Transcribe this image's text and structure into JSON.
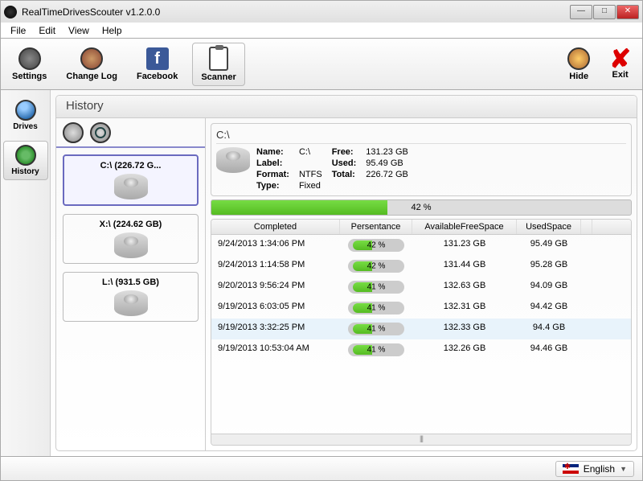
{
  "window": {
    "title": "RealTimeDrivesScouter v1.2.0.0"
  },
  "menu": {
    "file": "File",
    "edit": "Edit",
    "view": "View",
    "help": "Help"
  },
  "toolbar": {
    "settings": "Settings",
    "changelog": "Change Log",
    "facebook": "Facebook",
    "scanner": "Scanner",
    "hide": "Hide",
    "exit": "Exit"
  },
  "vtabs": {
    "drives": "Drives",
    "history": "History"
  },
  "panel": {
    "title": "History"
  },
  "drives": [
    {
      "label": "C:\\ (226.72 G..."
    },
    {
      "label": "X:\\ (224.62 GB)"
    },
    {
      "label": "L:\\ (931.5 GB)"
    }
  ],
  "detail": {
    "title": "C:\\",
    "name_k": "Name:",
    "name_v": "C:\\",
    "label_k": "Label:",
    "label_v": "",
    "format_k": "Format:",
    "format_v": "NTFS",
    "type_k": "Type:",
    "type_v": "Fixed",
    "free_k": "Free:",
    "free_v": "131.23 GB",
    "used_k": "Used:",
    "used_v": "95.49 GB",
    "total_k": "Total:",
    "total_v": "226.72 GB",
    "percent": "42 %"
  },
  "cols": {
    "c0": "Completed",
    "c1": "Persentance",
    "c2": "AvailableFreeSpace",
    "c3": "UsedSpace"
  },
  "rows": [
    {
      "completed": "9/24/2013 1:34:06 PM",
      "pct": "42 %",
      "free": "131.23 GB",
      "used": "95.49 GB"
    },
    {
      "completed": "9/24/2013 1:14:58 PM",
      "pct": "42 %",
      "free": "131.44 GB",
      "used": "95.28 GB"
    },
    {
      "completed": "9/20/2013 9:56:24 PM",
      "pct": "41 %",
      "free": "132.63 GB",
      "used": "94.09 GB"
    },
    {
      "completed": "9/19/2013 6:03:05 PM",
      "pct": "41 %",
      "free": "132.31 GB",
      "used": "94.42 GB"
    },
    {
      "completed": "9/19/2013 3:32:25 PM",
      "pct": "41 %",
      "free": "132.33 GB",
      "used": "94.4 GB"
    },
    {
      "completed": "9/19/2013 10:53:04 AM",
      "pct": "41 %",
      "free": "132.26 GB",
      "used": "94.46 GB"
    }
  ],
  "footer": {
    "lang": "English"
  }
}
